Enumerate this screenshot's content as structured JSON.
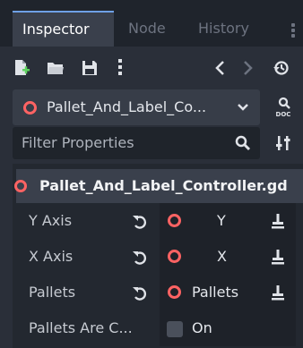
{
  "tabs": [
    {
      "label": "Inspector"
    },
    {
      "label": "Node"
    },
    {
      "label": "History"
    }
  ],
  "object": {
    "name": "Pallet_And_Label_Co..."
  },
  "filter": {
    "placeholder": "Filter Properties"
  },
  "script": {
    "title": "Pallet_And_Label_Controller.gd"
  },
  "properties": [
    {
      "label": "Y Axis",
      "value": "Y"
    },
    {
      "label": "X Axis",
      "value": "X"
    },
    {
      "label": "Pallets",
      "value": "Pallets"
    },
    {
      "label": "Pallets Are C...",
      "value": "On"
    }
  ],
  "colors": {
    "accent": "#6ea0e6",
    "node_red": "#ff6363",
    "panel": "#2a2f39"
  }
}
